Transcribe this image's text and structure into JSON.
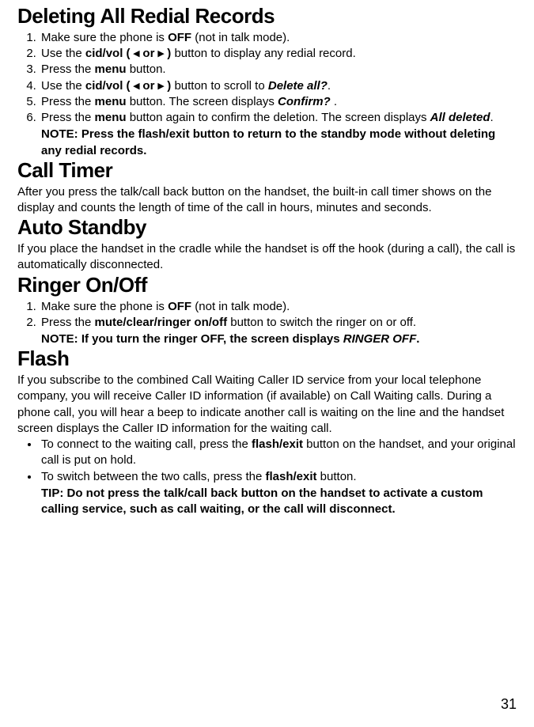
{
  "page_number": "31",
  "sections": {
    "deleting": {
      "heading": "Deleting All Redial Records",
      "steps": {
        "s1a": "Make sure the phone is ",
        "s1b": "OFF",
        "s1c": " (not in talk mode).",
        "s2a": "Use the ",
        "s2b": "cid/vol ( ◂ or ▸ )",
        "s2c": " button to display any redial record.",
        "s3a": "Press the ",
        "s3b": "menu",
        "s3c": " button.",
        "s4a": "Use the ",
        "s4b": "cid/vol ( ◂ or ▸ )",
        "s4c": " button to scroll to ",
        "s4d": "Delete all?",
        "s4e": ".",
        "s5a": "Press the ",
        "s5b": "menu",
        "s5c": " button. The screen displays ",
        "s5d": "Confirm?",
        "s5e": " .",
        "s6a": "Press the ",
        "s6b": "menu",
        "s6c": " button again to confirm the deletion. The screen displays ",
        "s6d": "All deleted",
        "s6e": "."
      },
      "note": "NOTE: Press the flash/exit button to return to the standby mode without deleting any redial records."
    },
    "calltimer": {
      "heading": "Call Timer",
      "p": "After you press the talk/call back button on the handset, the built-in call timer shows on the display and counts the length of time of the call in hours, minutes and seconds."
    },
    "autostandby": {
      "heading": "Auto Standby",
      "p": "If you place the handset in the cradle while the handset is off the hook (during a call), the call is automatically disconnected."
    },
    "ringer": {
      "heading": "Ringer On/Off",
      "steps": {
        "s1a": "Make sure the phone is ",
        "s1b": "OFF",
        "s1c": " (not in talk mode).",
        "s2a": "Press the ",
        "s2b": "mute/clear/ringer on/off",
        "s2c": " button to switch the ringer on or off."
      },
      "note_a": "NOTE: If you turn the ringer OFF, the screen displays ",
      "note_b": "RINGER OFF",
      "note_c": "."
    },
    "flash": {
      "heading": "Flash",
      "p": "If you subscribe to the combined Call Waiting Caller ID service from your local telephone company, you will receive Caller ID information (if available) on Call Waiting calls. During a phone call, you will hear a beep to indicate another call is waiting on the line and the handset screen displays the Caller ID information for the waiting call.",
      "b1a": "To connect to the waiting call, press the ",
      "b1b": "flash/exit",
      "b1c": " button on the handset, and your original call is put on hold.",
      "b2a": "To switch between the two calls, press the ",
      "b2b": "flash/exit",
      "b2c": " button.",
      "tip": "TIP: Do not press the talk/call back button on the handset to activate a custom calling service, such as call waiting, or the call will disconnect."
    }
  }
}
